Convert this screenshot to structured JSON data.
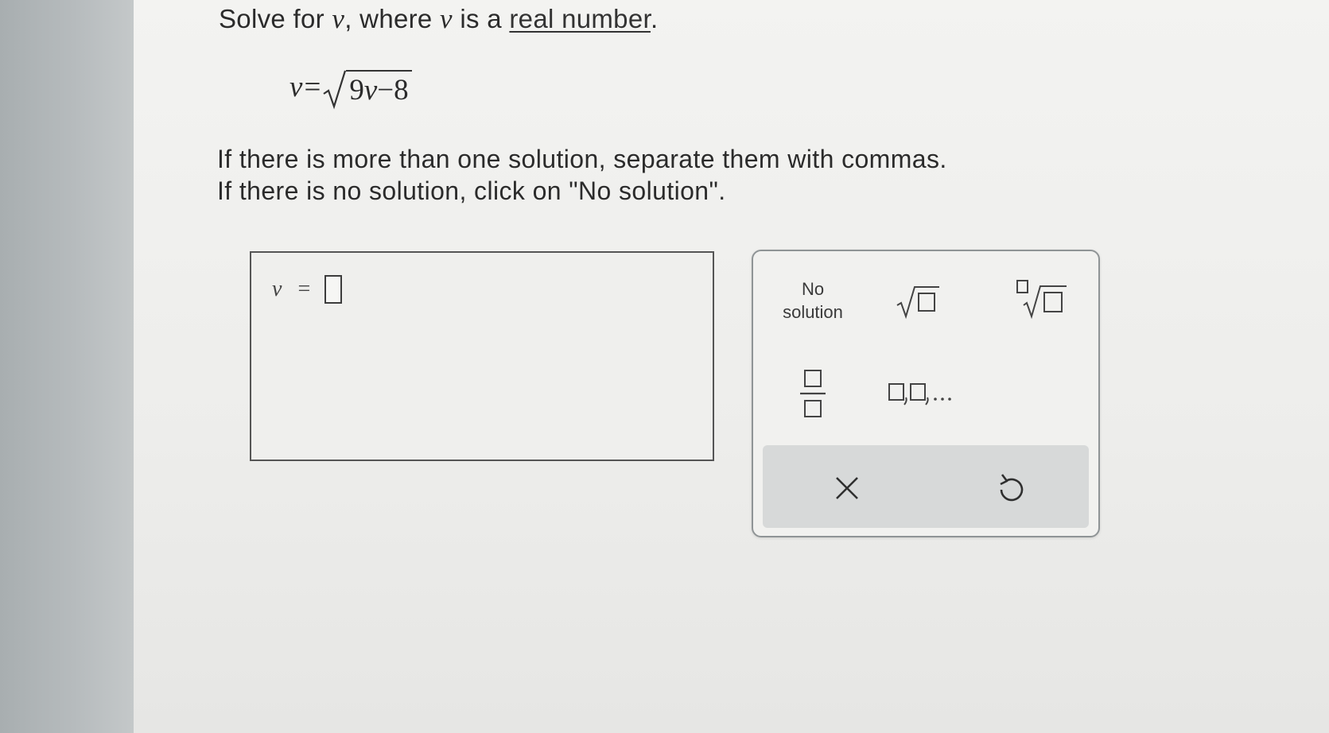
{
  "question": {
    "prefix": "Solve for ",
    "variable": "v",
    "middle": ", where ",
    "variable2": "v",
    "suffix_before_link": " is a ",
    "link_text": "real number",
    "end": "."
  },
  "equation": {
    "lhs": "v",
    "equals": "=",
    "radicand_coefficient": "9",
    "radicand_variable": "v",
    "radicand_rest": "−8"
  },
  "instructions": {
    "line1": "If there is more than one solution, separate them with commas.",
    "line2": "If there is no solution, click on \"No solution\"."
  },
  "answer": {
    "variable": "v",
    "equals": "=",
    "value": ""
  },
  "keypad": {
    "no_solution_line1": "No",
    "no_solution_line2": "solution",
    "icons": [
      "sqrt-template-icon",
      "nth-root-template-icon",
      "fraction-template-icon",
      "list-template-icon",
      "clear-x-icon",
      "undo-icon"
    ]
  },
  "colors": {
    "page_bg": "#ececea",
    "left_strip": "#b2b7b9",
    "keypad_border": "#8f9496",
    "action_bar": "#d7d9d9",
    "text": "#2b2b2b"
  }
}
